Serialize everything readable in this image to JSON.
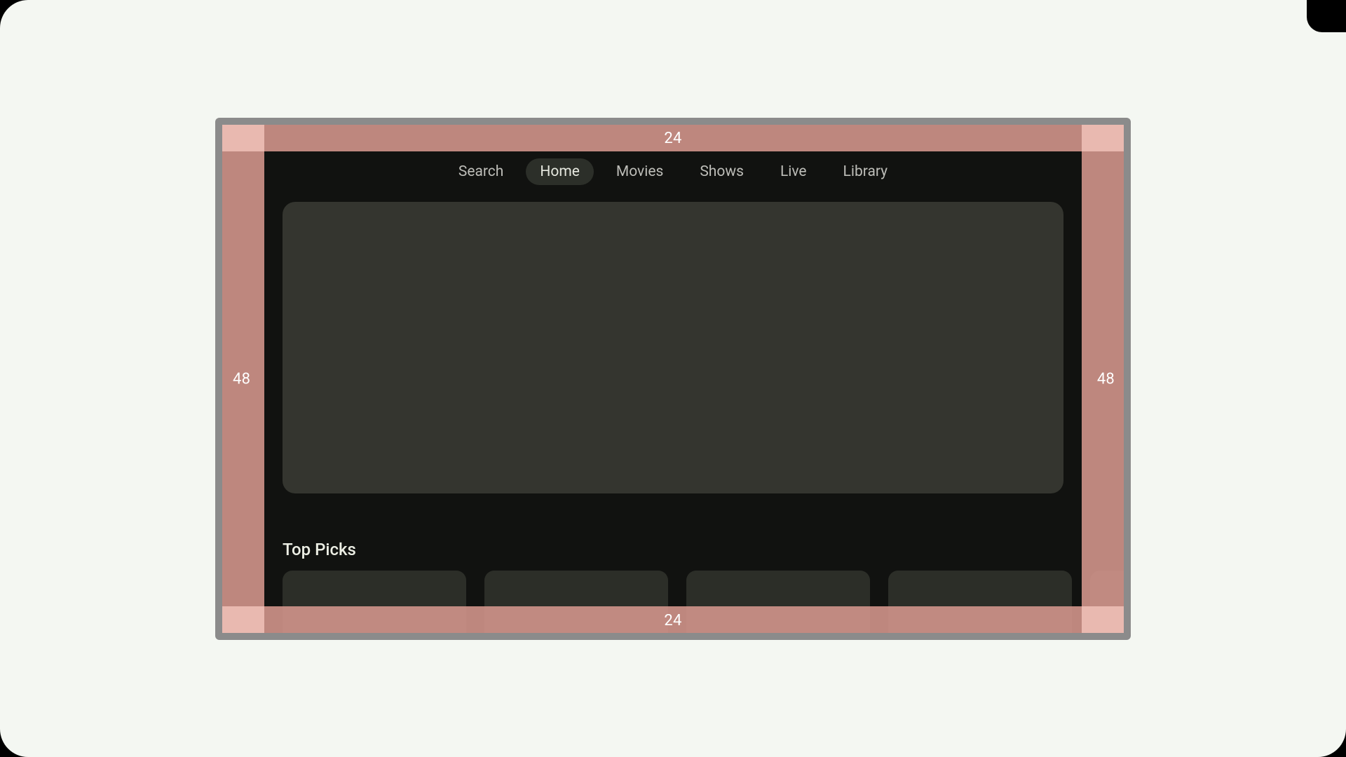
{
  "overscan": {
    "top": "24",
    "bottom": "24",
    "left": "48",
    "right": "48"
  },
  "nav": {
    "items": [
      {
        "label": "Search",
        "active": false
      },
      {
        "label": "Home",
        "active": true
      },
      {
        "label": "Movies",
        "active": false
      },
      {
        "label": "Shows",
        "active": false
      },
      {
        "label": "Live",
        "active": false
      },
      {
        "label": "Library",
        "active": false
      }
    ]
  },
  "section": {
    "title": "Top Picks"
  },
  "colors": {
    "page_bg": "#f4f7f2",
    "frame": "#8b8b8b",
    "screen": "#111210",
    "hero": "#34352f",
    "card": "#2c2e28",
    "overscan": "#d6978d",
    "tab_active_bg": "#2c2f29"
  }
}
